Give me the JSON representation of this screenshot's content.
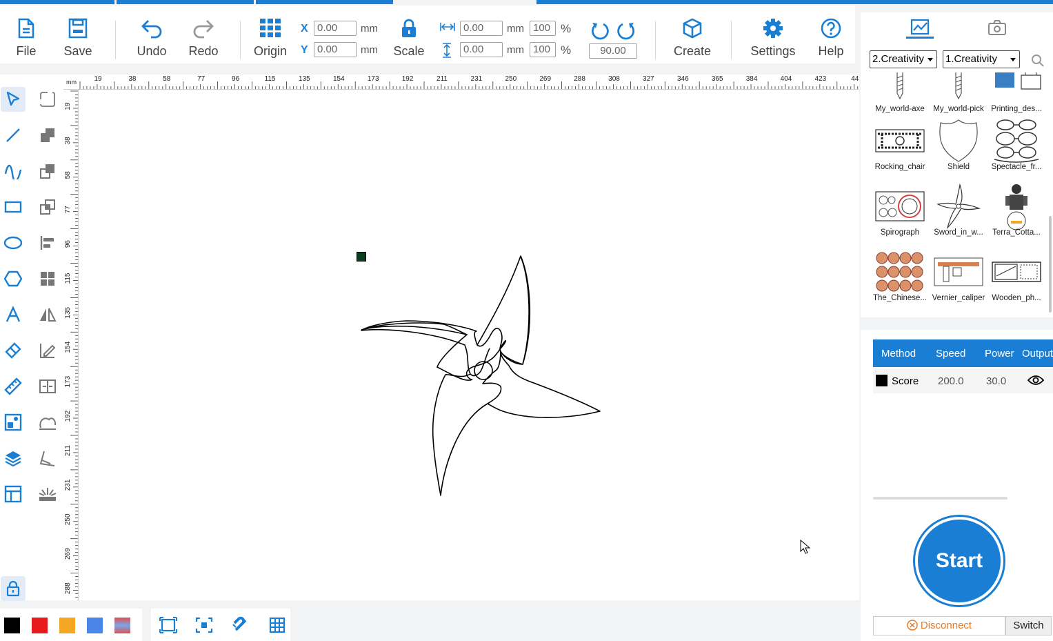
{
  "toolbar": {
    "file": "File",
    "save": "Save",
    "undo": "Undo",
    "redo": "Redo",
    "origin": "Origin",
    "x_label": "X",
    "y_label": "Y",
    "x_value": "0.00",
    "y_value": "0.00",
    "unit": "mm",
    "scale": "Scale",
    "width_value": "0.00",
    "height_value": "0.00",
    "width_pct": "100",
    "height_pct": "100",
    "percent": "%",
    "rotation": "90.00",
    "create": "Create",
    "settings": "Settings",
    "help": "Help"
  },
  "ruler": {
    "unit": "mm",
    "top_ticks": [
      "19",
      "38",
      "58",
      "77",
      "96",
      "115",
      "135",
      "154",
      "173",
      "192",
      "211",
      "231",
      "250",
      "269",
      "288",
      "308",
      "327",
      "346",
      "365",
      "384",
      "404",
      "423",
      "44"
    ],
    "left_ticks": [
      "19",
      "38",
      "58",
      "77",
      "96",
      "115",
      "135",
      "154",
      "173",
      "192",
      "211",
      "231",
      "250",
      "269",
      "288"
    ]
  },
  "library": {
    "category1": "2.Creativity",
    "category2": "1.Creativity",
    "items": [
      {
        "name": "My_world-axe"
      },
      {
        "name": "My_world-pick"
      },
      {
        "name": "Printing_des..."
      },
      {
        "name": "Rocking_chair"
      },
      {
        "name": "Shield"
      },
      {
        "name": "Spectacle_fr..."
      },
      {
        "name": "Spirograph"
      },
      {
        "name": "Sword_in_w..."
      },
      {
        "name": "Terra_Cotta..."
      },
      {
        "name": "The_Chinese..."
      },
      {
        "name": "Vernier_caliper"
      },
      {
        "name": "Wooden_ph..."
      }
    ]
  },
  "layers": {
    "headers": {
      "method": "Method",
      "speed": "Speed",
      "power": "Power",
      "output": "Output"
    },
    "rows": [
      {
        "method": "Score",
        "speed": "200.0",
        "power": "30.0",
        "color": "#000000"
      }
    ]
  },
  "actions": {
    "start": "Start",
    "disconnect": "Disconnect",
    "switch": "Switch"
  },
  "colors": {
    "accent": "#1a7fd4",
    "swatches": [
      "#000000",
      "#e8191b",
      "#f5a623",
      "#4a86e8"
    ]
  },
  "icons": [
    "file-icon",
    "save-icon",
    "undo-icon",
    "redo-icon",
    "origin-grid-icon",
    "lock-icon",
    "rotate-ccw-icon",
    "rotate-cw-icon",
    "cube-icon",
    "gear-icon",
    "help-icon"
  ]
}
